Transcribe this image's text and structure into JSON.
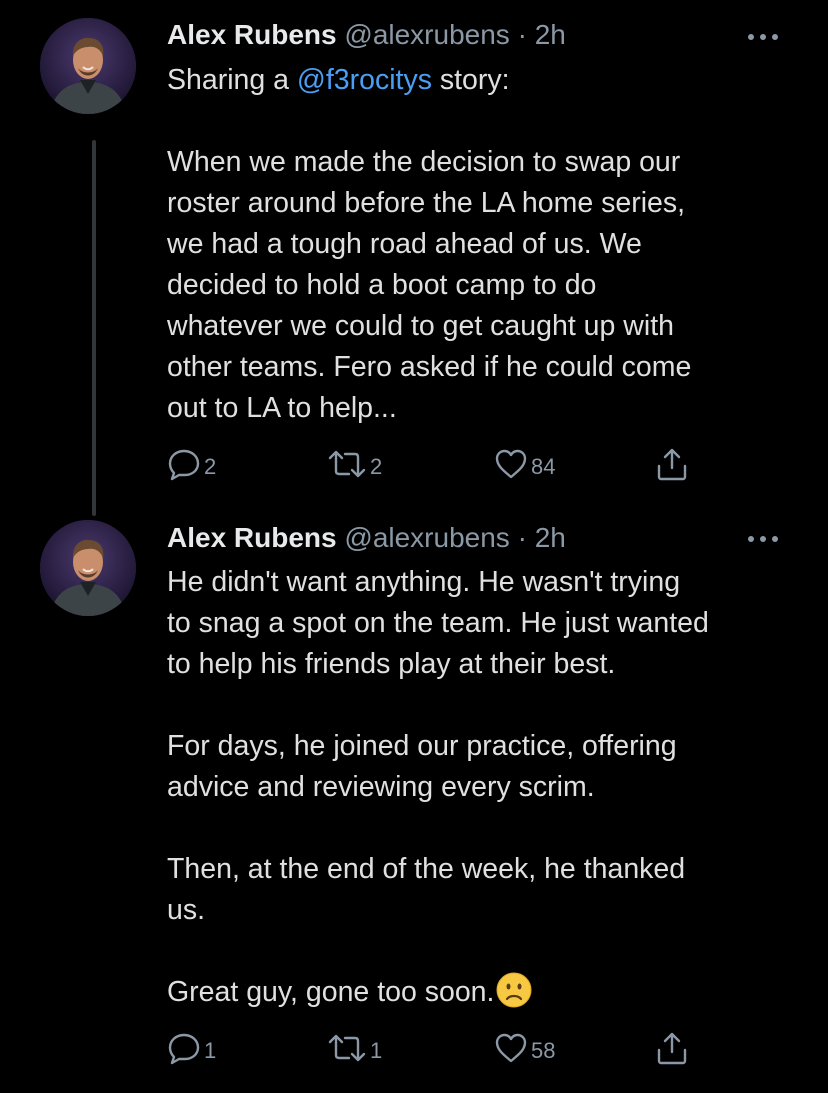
{
  "thread": {
    "tweets": [
      {
        "author_name": "Alex Rubens",
        "author_handle": "@alexrubens",
        "separator": "·",
        "timestamp": "2h",
        "text_lines": [
          [
            "Sharing a ",
            "@f3rocitys",
            " story:"
          ],
          "",
          "When we made the decision to swap our",
          "roster around before the LA home series,",
          "we had a tough road ahead of us. We",
          "decided to hold a boot camp to do",
          "whatever we could to get caught up with",
          "other teams. Fero asked if he could come",
          "out to LA to help..."
        ],
        "line1_prefix": "Sharing a ",
        "line1_mention": "@f3rocitys",
        "line1_suffix": " story:",
        "paragraph_lines": [
          "When we made the decision to swap our",
          "roster around before the LA home series,",
          "we had a tough road ahead of us. We",
          "decided to hold a boot camp to do",
          "whatever we could to get caught up with",
          "other teams. Fero asked if he could come",
          "out to LA to help..."
        ],
        "reply_count": "2",
        "retweet_count": "2",
        "like_count": "84"
      },
      {
        "author_name": "Alex Rubens",
        "author_handle": "@alexrubens",
        "separator": "·",
        "timestamp": "2h",
        "paragraph_1": [
          "He didn't want anything. He wasn't trying",
          "to snag a spot on the team. He just wanted",
          "to help his friends play at their best."
        ],
        "paragraph_2": [
          "For days, he joined our practice, offering",
          "advice and reviewing every scrim."
        ],
        "paragraph_3": [
          "Then, at the end of the week, he thanked",
          "us."
        ],
        "paragraph_4": "Great guy, gone too soon.",
        "emoji": "slightly-frowning-face",
        "reply_count": "1",
        "retweet_count": "1",
        "like_count": "58"
      }
    ]
  },
  "icons": {
    "more": "more-icon",
    "reply": "reply-icon",
    "retweet": "retweet-icon",
    "like": "like-icon",
    "share": "share-icon"
  },
  "colors": {
    "background": "#000000",
    "text": "#e0e0e0",
    "secondary": "#8b98a5",
    "mention": "#4a9ff5",
    "thread_line": "#333639"
  }
}
